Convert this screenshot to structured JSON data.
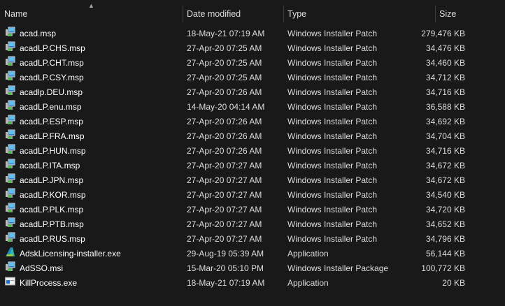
{
  "columns": {
    "name": "Name",
    "date": "Date modified",
    "type": "Type",
    "size": "Size"
  },
  "files": [
    {
      "name": "acad.msp",
      "date": "18-May-21 07:19 AM",
      "type": "Windows Installer Patch",
      "size": "279,476 KB",
      "icon": "installer-patch-icon"
    },
    {
      "name": "acadLP.CHS.msp",
      "date": "27-Apr-20 07:25 AM",
      "type": "Windows Installer Patch",
      "size": "34,476 KB",
      "icon": "installer-patch-icon"
    },
    {
      "name": "acadLP.CHT.msp",
      "date": "27-Apr-20 07:25 AM",
      "type": "Windows Installer Patch",
      "size": "34,460 KB",
      "icon": "installer-patch-icon"
    },
    {
      "name": "acadLP.CSY.msp",
      "date": "27-Apr-20 07:25 AM",
      "type": "Windows Installer Patch",
      "size": "34,712 KB",
      "icon": "installer-patch-icon"
    },
    {
      "name": "acadlp.DEU.msp",
      "date": "27-Apr-20 07:26 AM",
      "type": "Windows Installer Patch",
      "size": "34,716 KB",
      "icon": "installer-patch-icon"
    },
    {
      "name": "acadLP.enu.msp",
      "date": "14-May-20 04:14 AM",
      "type": "Windows Installer Patch",
      "size": "36,588 KB",
      "icon": "installer-patch-icon"
    },
    {
      "name": "acadLP.ESP.msp",
      "date": "27-Apr-20 07:26 AM",
      "type": "Windows Installer Patch",
      "size": "34,692 KB",
      "icon": "installer-patch-icon"
    },
    {
      "name": "acadLP.FRA.msp",
      "date": "27-Apr-20 07:26 AM",
      "type": "Windows Installer Patch",
      "size": "34,704 KB",
      "icon": "installer-patch-icon"
    },
    {
      "name": "acadLP.HUN.msp",
      "date": "27-Apr-20 07:26 AM",
      "type": "Windows Installer Patch",
      "size": "34,716 KB",
      "icon": "installer-patch-icon"
    },
    {
      "name": "acadLP.ITA.msp",
      "date": "27-Apr-20 07:27 AM",
      "type": "Windows Installer Patch",
      "size": "34,672 KB",
      "icon": "installer-patch-icon"
    },
    {
      "name": "acadLP.JPN.msp",
      "date": "27-Apr-20 07:27 AM",
      "type": "Windows Installer Patch",
      "size": "34,672 KB",
      "icon": "installer-patch-icon"
    },
    {
      "name": "acadLP.KOR.msp",
      "date": "27-Apr-20 07:27 AM",
      "type": "Windows Installer Patch",
      "size": "34,540 KB",
      "icon": "installer-patch-icon"
    },
    {
      "name": "acadLP.PLK.msp",
      "date": "27-Apr-20 07:27 AM",
      "type": "Windows Installer Patch",
      "size": "34,720 KB",
      "icon": "installer-patch-icon"
    },
    {
      "name": "acadLP.PTB.msp",
      "date": "27-Apr-20 07:27 AM",
      "type": "Windows Installer Patch",
      "size": "34,652 KB",
      "icon": "installer-patch-icon"
    },
    {
      "name": "acadLP.RUS.msp",
      "date": "27-Apr-20 07:27 AM",
      "type": "Windows Installer Patch",
      "size": "34,796 KB",
      "icon": "installer-patch-icon"
    },
    {
      "name": "AdskLicensing-installer.exe",
      "date": "29-Aug-19 05:39 AM",
      "type": "Application",
      "size": "56,144 KB",
      "icon": "autodesk-logo-icon"
    },
    {
      "name": "AdSSO.msi",
      "date": "15-Mar-20 05:10 PM",
      "type": "Windows Installer Package",
      "size": "100,772 KB",
      "icon": "installer-patch-icon"
    },
    {
      "name": "KillProcess.exe",
      "date": "18-May-21 07:19 AM",
      "type": "Application",
      "size": "20 KB",
      "icon": "application-window-icon"
    }
  ]
}
